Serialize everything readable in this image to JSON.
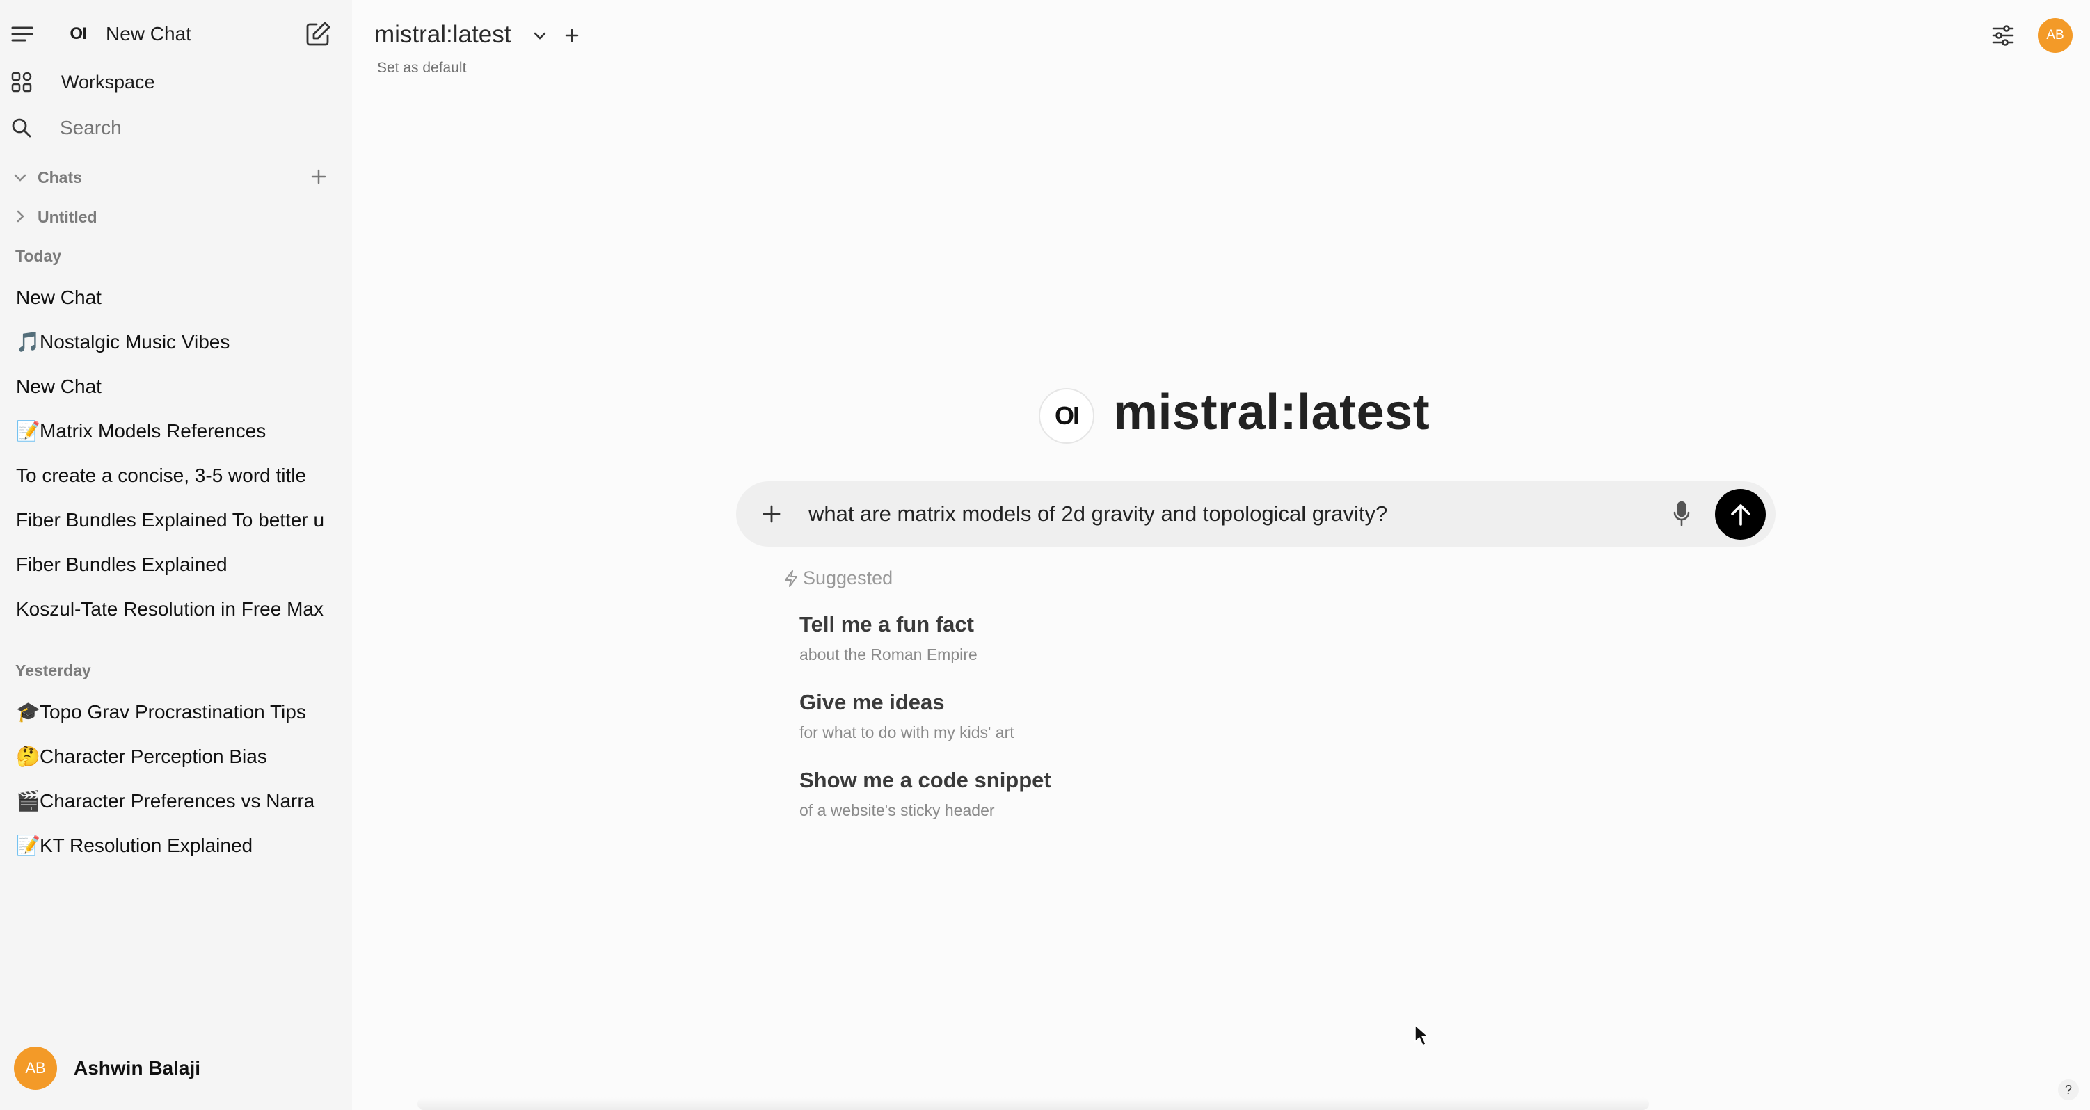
{
  "sidebar": {
    "new_chat_label": "New Chat",
    "logo_text": "OI",
    "workspace_label": "Workspace",
    "search_placeholder": "Search",
    "chats_label": "Chats",
    "folder_label": "Untitled",
    "today_label": "Today",
    "today_items": [
      {
        "emoji": "",
        "title": "New Chat"
      },
      {
        "emoji": "🎵",
        "title": "Nostalgic Music Vibes"
      },
      {
        "emoji": "",
        "title": "New Chat"
      },
      {
        "emoji": "📝",
        "title": "Matrix Models References"
      },
      {
        "emoji": "",
        "title": "To create a concise, 3-5 word title"
      },
      {
        "emoji": "",
        "title": "Fiber Bundles Explained To better u"
      },
      {
        "emoji": "",
        "title": "Fiber Bundles Explained"
      },
      {
        "emoji": "",
        "title": "Koszul-Tate Resolution in Free Max"
      }
    ],
    "yesterday_label": "Yesterday",
    "yesterday_items": [
      {
        "emoji": "🎓",
        "title": "Topo Grav Procrastination Tips"
      },
      {
        "emoji": "🤔",
        "title": "Character Perception Bias"
      },
      {
        "emoji": "🎬",
        "title": "Character Preferences vs Narra"
      },
      {
        "emoji": "📝",
        "title": "KT Resolution Explained"
      }
    ],
    "user": {
      "initials": "AB",
      "name": "Ashwin Balaji"
    }
  },
  "header": {
    "model_name": "mistral:latest",
    "set_default_label": "Set as default",
    "avatar_initials": "AB"
  },
  "main": {
    "logo_text": "OI",
    "hero_title": "mistral:latest",
    "input_value": "what are matrix models of 2d gravity and topological gravity?",
    "suggested_label": "Suggested",
    "suggestions": [
      {
        "title": "Tell me a fun fact",
        "subtitle": "about the Roman Empire"
      },
      {
        "title": "Give me ideas",
        "subtitle": "for what to do with my kids' art"
      },
      {
        "title": "Show me a code snippet",
        "subtitle": "of a website's sticky header"
      }
    ],
    "help_label": "?"
  },
  "colors": {
    "avatar": "#f39a28",
    "sidebar_bg": "#f5f5f5",
    "main_bg": "#fbfbfb",
    "input_bg": "#efefef",
    "send_button": "#000000"
  }
}
